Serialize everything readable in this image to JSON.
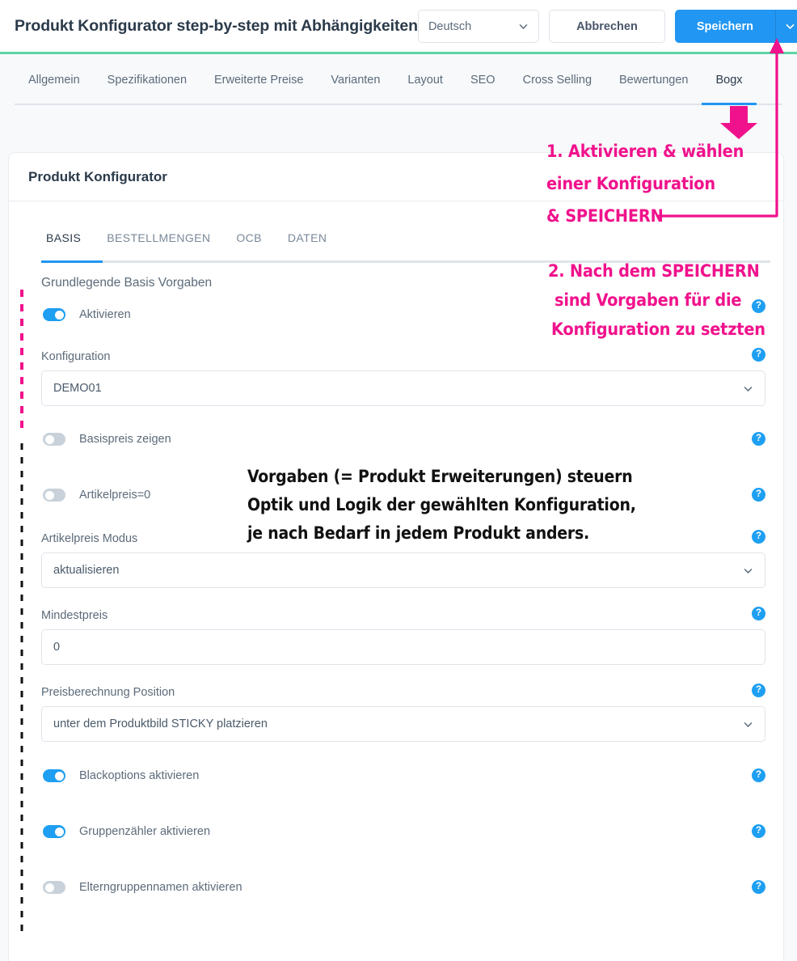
{
  "header": {
    "title": "Produkt Konfigurator step-by-step mit Abhängigkeiten",
    "language": "Deutsch",
    "cancel_label": "Abbrechen",
    "save_label": "Speichern"
  },
  "tabs": [
    {
      "label": "Allgemein",
      "active": false
    },
    {
      "label": "Spezifikationen",
      "active": false
    },
    {
      "label": "Erweiterte Preise",
      "active": false
    },
    {
      "label": "Varianten",
      "active": false
    },
    {
      "label": "Layout",
      "active": false
    },
    {
      "label": "SEO",
      "active": false
    },
    {
      "label": "Cross Selling",
      "active": false
    },
    {
      "label": "Bewertungen",
      "active": false
    },
    {
      "label": "Bogx",
      "active": true
    }
  ],
  "card": {
    "title": "Produkt Konfigurator",
    "subtabs": [
      {
        "label": "BASIS",
        "active": true
      },
      {
        "label": "BESTELLMENGEN",
        "active": false
      },
      {
        "label": "OCB",
        "active": false
      },
      {
        "label": "DATEN",
        "active": false
      }
    ],
    "section_title": "Grundlegende Basis Vorgaben",
    "fields": {
      "aktivieren": {
        "label": "Aktivieren",
        "state": "on"
      },
      "konfiguration": {
        "label": "Konfiguration",
        "value": "DEMO01"
      },
      "basispreis": {
        "label": "Basispreis zeigen",
        "state": "off"
      },
      "artikelpreis0": {
        "label": "Artikelpreis=0",
        "state": "off"
      },
      "artikelpreis_modus": {
        "label": "Artikelpreis Modus",
        "value": "aktualisieren"
      },
      "mindestpreis": {
        "label": "Mindestpreis",
        "value": "0"
      },
      "preisberechnung": {
        "label": "Preisberechnung Position",
        "value": "unter dem Produktbild STICKY platzieren"
      },
      "blackoptions": {
        "label": "Blackoptions aktivieren",
        "state": "on"
      },
      "gruppenzaehler": {
        "label": "Gruppenzähler aktivieren",
        "state": "on"
      },
      "elterngruppennamen": {
        "label": "Elterngruppennamen aktivieren",
        "state": "off"
      }
    },
    "help_symbol": "?"
  },
  "annotations": {
    "step1_line1": "1. Aktivieren & wählen",
    "step1_line2": "einer Konfiguration",
    "step1_line3": "& SPEICHERN",
    "step2_line1": "2. Nach dem SPEICHERN",
    "step2_line2": "sind Vorgaben für die",
    "step2_line3": "Konfiguration zu setzten",
    "note_line1": "Vorgaben (= Produkt Erweiterungen) steuern",
    "note_line2": "Optik und Logik der gewählten Konfiguration,",
    "note_line3": "je nach Bedarf in jedem Produkt anders."
  },
  "colors": {
    "accent_blue": "#2196f3",
    "annotation_pink": "#f0128c",
    "rule_green": "#5ed6a4",
    "note_black": "#111111"
  }
}
